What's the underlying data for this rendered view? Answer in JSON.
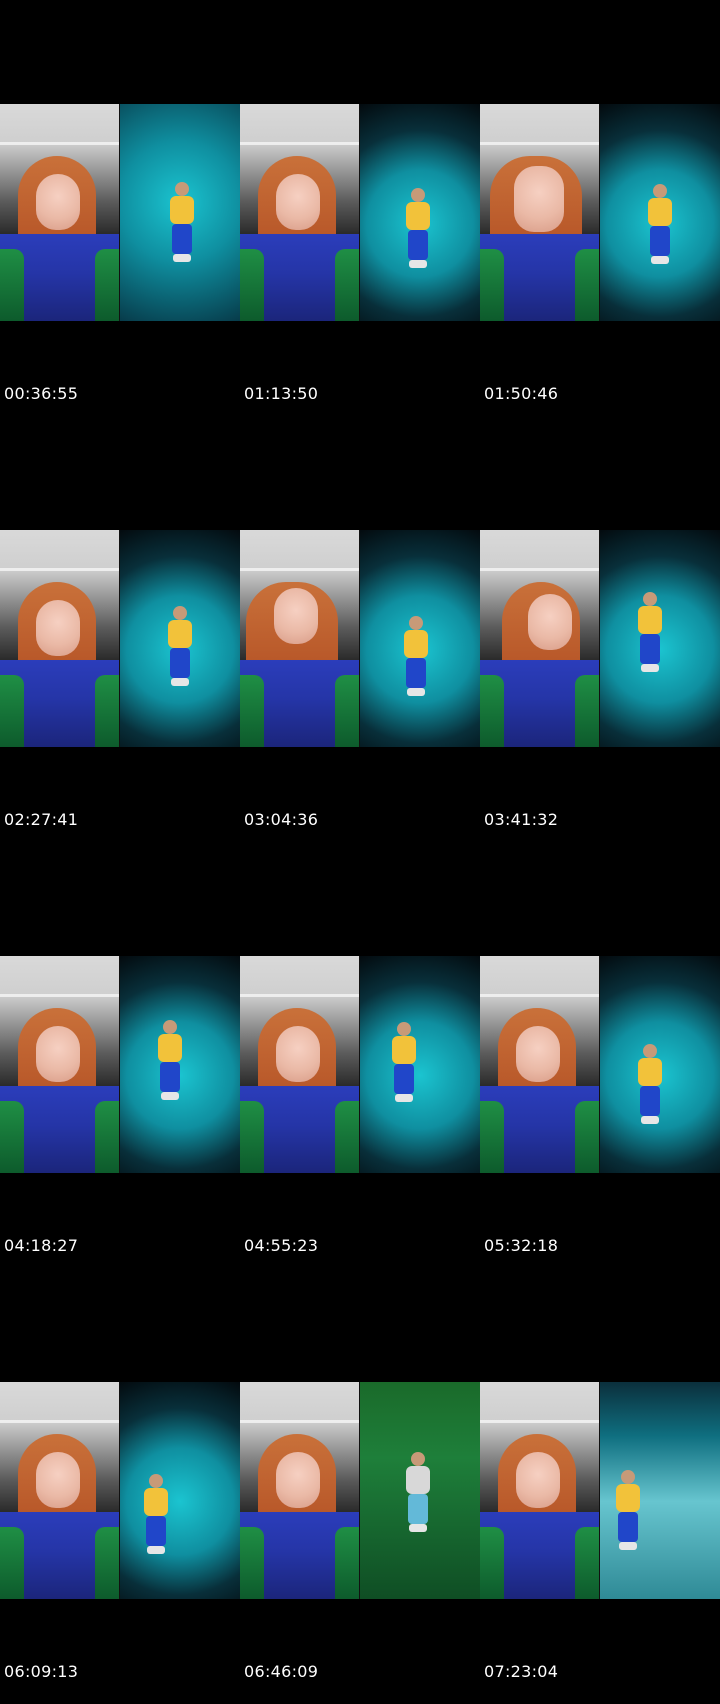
{
  "timestamps": [
    "00:36:55",
    "01:13:50",
    "01:50:46",
    "02:27:41",
    "03:04:36",
    "03:41:32",
    "04:18:27",
    "04:55:23",
    "05:32:18",
    "06:09:13",
    "06:46:09",
    "07:23:04"
  ],
  "icons": {
    "left": "person-video-frame",
    "right": "game-character-frame"
  },
  "colors": {
    "background": "#000000",
    "label": "#ffffff",
    "shirt": "#2535a7",
    "hair": "#b9592a",
    "game_bg": "#0f8fa0"
  }
}
